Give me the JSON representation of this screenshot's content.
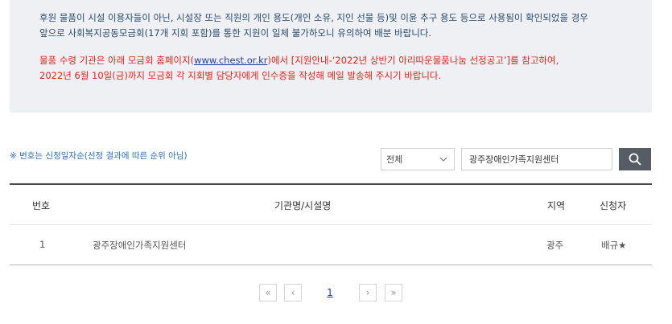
{
  "notice": {
    "line1": "후원 물품이 시설 이용자들이 아닌, 시설장 또는 직원의 개인 용도(개인 소유, 지인 선물 등)및 이윤 추구 용도 등으로 사용됨이 확인되었을 경우",
    "line2": "앞으로 사회복지공동모금회(17개 지회 포함)를 통한 지원이 일체 불가하오니 유의하여 배분 바랍니다.",
    "line3_prefix": "물품 수령 기관은 아래 모금회 홈페이지(",
    "line3_link": "www.chest.or.kr",
    "line3_suffix": ")에서 [지원안내-‘2022년 상반기 아리따운물품나눔 선정공고’]를 참고하여,",
    "line4": "2022년 6월 10일(금)까지 모금회 각 지회별 담당자에게 인수증을 작성해 메일 발송해 주시기 바랍니다."
  },
  "hint": "※ 번호는 신청일자순(선정 결과에 따른 순위 아님)",
  "search": {
    "filter_value": "전체",
    "query": "광주장애인가족지원센터",
    "button_icon": "search-icon"
  },
  "table": {
    "headers": [
      "번호",
      "기관명/시설명",
      "지역",
      "신청자"
    ],
    "rows": [
      {
        "no": "1",
        "name": "광주장애인가족지원센터",
        "region": "광주",
        "applicant": "배규★"
      }
    ]
  },
  "pagination": {
    "first": "«",
    "prev": "‹",
    "current": "1",
    "next": "›",
    "last": "»"
  },
  "colors": {
    "notice_bg": "#eef0f4",
    "notice_text": "#2a4a6a",
    "warning_text": "#e2231a",
    "link": "#1f3f9f",
    "hint_text": "#2a6fb7",
    "search_button": "#555c63"
  }
}
